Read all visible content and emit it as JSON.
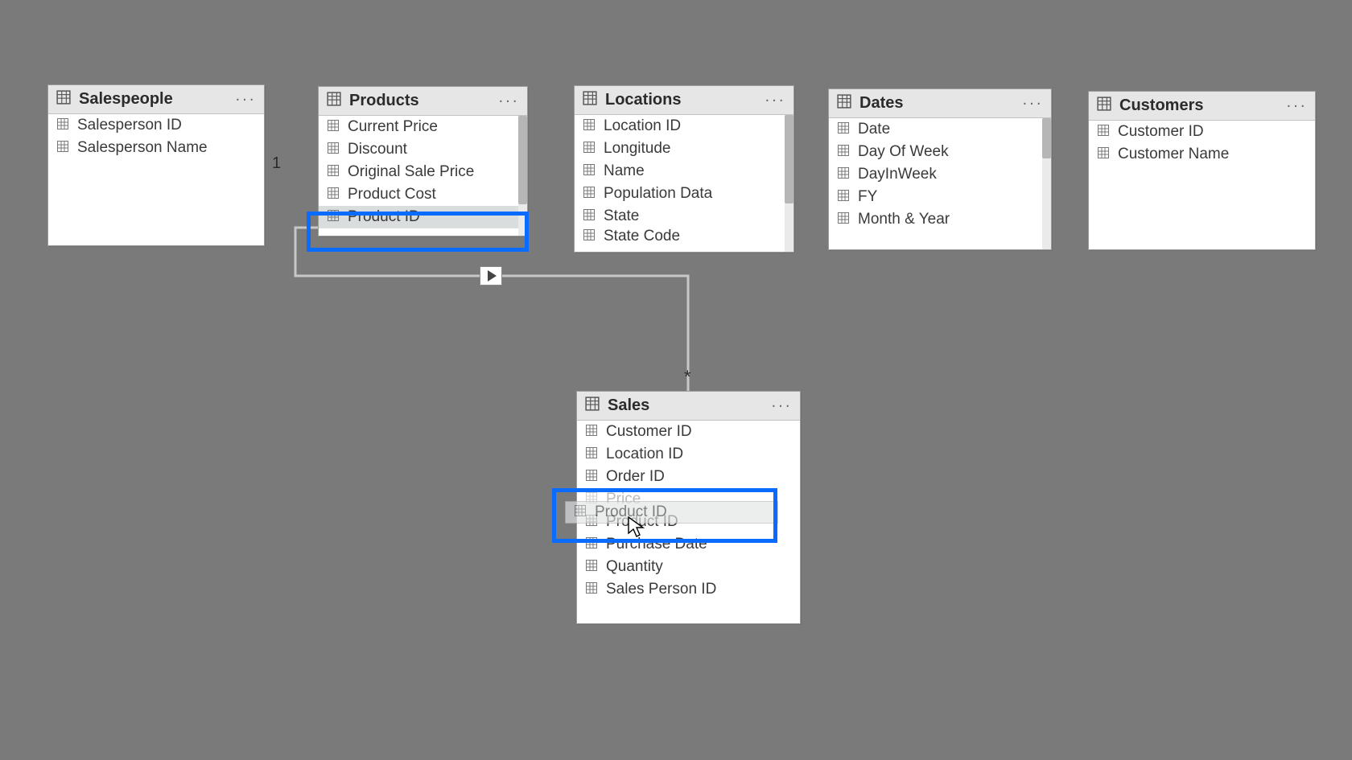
{
  "relationship": {
    "from_table": "Products",
    "from_field": "Product ID",
    "to_table": "Sales",
    "to_field": "Product ID",
    "from_cardinality": "1",
    "to_cardinality": "*"
  },
  "drag": {
    "ghost_label": "Product ID"
  },
  "tables": {
    "salespeople": {
      "title": "Salespeople",
      "fields": [
        "Salesperson ID",
        "Salesperson Name"
      ]
    },
    "products": {
      "title": "Products",
      "fields": [
        "Current Price",
        "Discount",
        "Original Sale Price",
        "Product Cost",
        "Product ID"
      ],
      "selected_index": 4
    },
    "locations": {
      "title": "Locations",
      "fields": [
        "Location ID",
        "Longitude",
        "Name",
        "Population Data",
        "State",
        "State Code"
      ]
    },
    "dates": {
      "title": "Dates",
      "fields": [
        "Date",
        "Day Of Week",
        "DayInWeek",
        "FY",
        "Month & Year"
      ]
    },
    "customers": {
      "title": "Customers",
      "fields": [
        "Customer ID",
        "Customer Name"
      ]
    },
    "sales": {
      "title": "Sales",
      "fields": [
        "Customer ID",
        "Location ID",
        "Order ID",
        "Price",
        "Product ID",
        "Purchase Date",
        "Quantity",
        "Sales Person ID"
      ],
      "hover_index": 4,
      "faded_index": 3
    }
  }
}
